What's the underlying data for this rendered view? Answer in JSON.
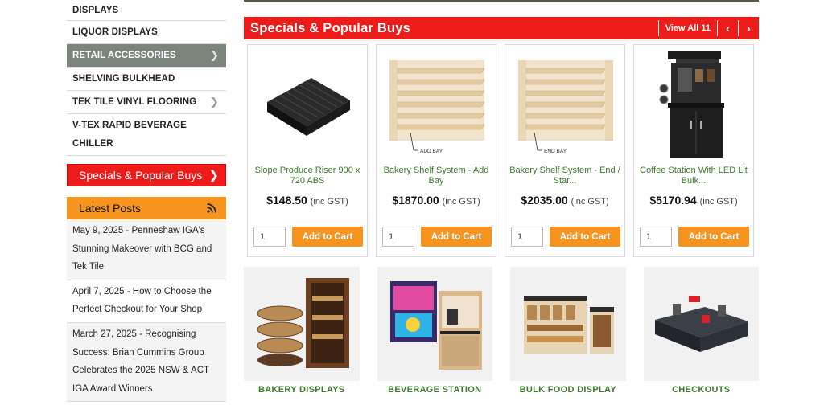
{
  "sidebar": {
    "categories": [
      {
        "label": "DISPLAYS",
        "active": false,
        "has_chevron": false
      },
      {
        "label": "LIQUOR DISPLAYS",
        "active": false,
        "has_chevron": false
      },
      {
        "label": "RETAIL ACCESSORIES",
        "active": true,
        "has_chevron": true
      },
      {
        "label": "SHELVING BULKHEAD",
        "active": false,
        "has_chevron": false
      },
      {
        "label": "TEK TILE VINYL FLOORING",
        "active": false,
        "has_chevron": true
      },
      {
        "label": "V-TEX RAPID BEVERAGE CHILLER",
        "active": false,
        "has_chevron": false
      }
    ],
    "specials_label": "Specials & Popular Buys",
    "latest_posts_title": "Latest Posts",
    "posts": [
      {
        "text": "May 9, 2025 - Penneshaw IGA's Stunning Makeover with BCG and Tek Tile"
      },
      {
        "text": "April 7, 2025 - How to Choose the Perfect Checkout for Your Shop"
      },
      {
        "text": "March 27, 2025 - Recognising Success: Brian Cummins Group Celebrates the 2025 NSW & ACT IGA Award Winners"
      }
    ]
  },
  "specials": {
    "title": "Specials & Popular Buys",
    "view_all": "View All 11",
    "prev_icon": "chevron-left-icon",
    "next_icon": "chevron-right-icon",
    "products": [
      {
        "name": "Slope Produce Riser 900 x 720 ABS",
        "price": "$148.50",
        "gst": "(inc GST)",
        "qty": "1",
        "cart_label": "Add to Cart",
        "img_caption": ""
      },
      {
        "name": "Bakery Shelf System - Add Bay",
        "price": "$1870.00",
        "gst": "(inc GST)",
        "qty": "1",
        "cart_label": "Add to Cart",
        "img_caption": "ADD BAY"
      },
      {
        "name": "Bakery Shelf System - End / Star...",
        "price": "$2035.00",
        "gst": "(inc GST)",
        "qty": "1",
        "cart_label": "Add to Cart",
        "img_caption": "END BAY"
      },
      {
        "name": "Coffee Station With LED Lit Bulk...",
        "price": "$5170.94",
        "gst": "(inc GST)",
        "qty": "1",
        "cart_label": "Add to Cart",
        "img_caption": ""
      }
    ]
  },
  "category_tiles": [
    {
      "label": "BAKERY DISPLAYS"
    },
    {
      "label": "BEVERAGE STATION"
    },
    {
      "label": "BULK FOOD DISPLAY"
    },
    {
      "label": "CHECKOUTS"
    }
  ],
  "colors": {
    "red": "#ee1b1b",
    "orange": "#f7941d",
    "active_gray": "#7b857b",
    "product_green": "#3a7a2a"
  }
}
